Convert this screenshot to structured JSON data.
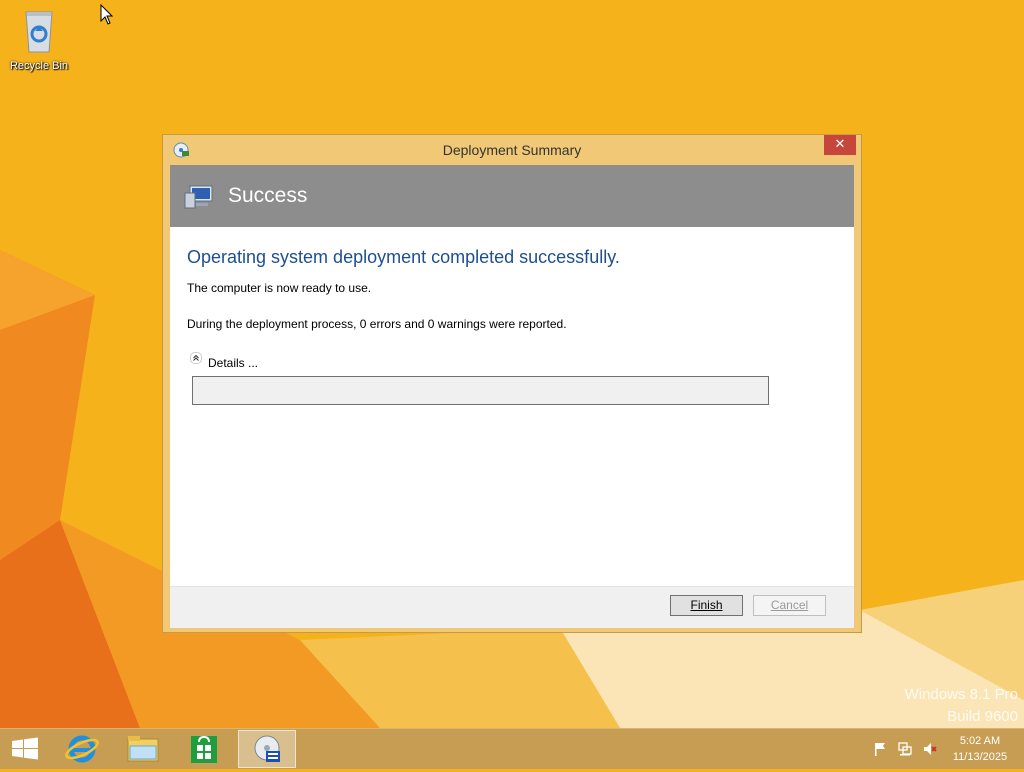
{
  "desktop": {
    "recycle_bin_label": "Recycle Bin",
    "watermark_line1": "Windows 8.1 Pro",
    "watermark_line2": "Build 9600",
    "background_color": "#f6b21b"
  },
  "dialog": {
    "title": "Deployment Summary",
    "close_label": "✕",
    "banner_title": "Success",
    "headline": "Operating system deployment completed successfully.",
    "message1": "The computer is now ready to use.",
    "message2": "During the deployment process, 0 errors and 0 warnings were reported.",
    "details_label": "Details ...",
    "finish_label": "Finish",
    "cancel_label": "Cancel",
    "headline_color": "#1d4f91",
    "banner_color": "#8d8d8d"
  },
  "taskbar": {
    "items": [
      "start-icon",
      "internet-explorer-icon",
      "file-explorer-icon",
      "store-icon",
      "deployment-icon"
    ],
    "clock_time": "5:02 AM",
    "clock_date": "11/13/2025",
    "tray_icons": [
      "flag-icon",
      "network-icon",
      "volume-muted-icon"
    ]
  }
}
